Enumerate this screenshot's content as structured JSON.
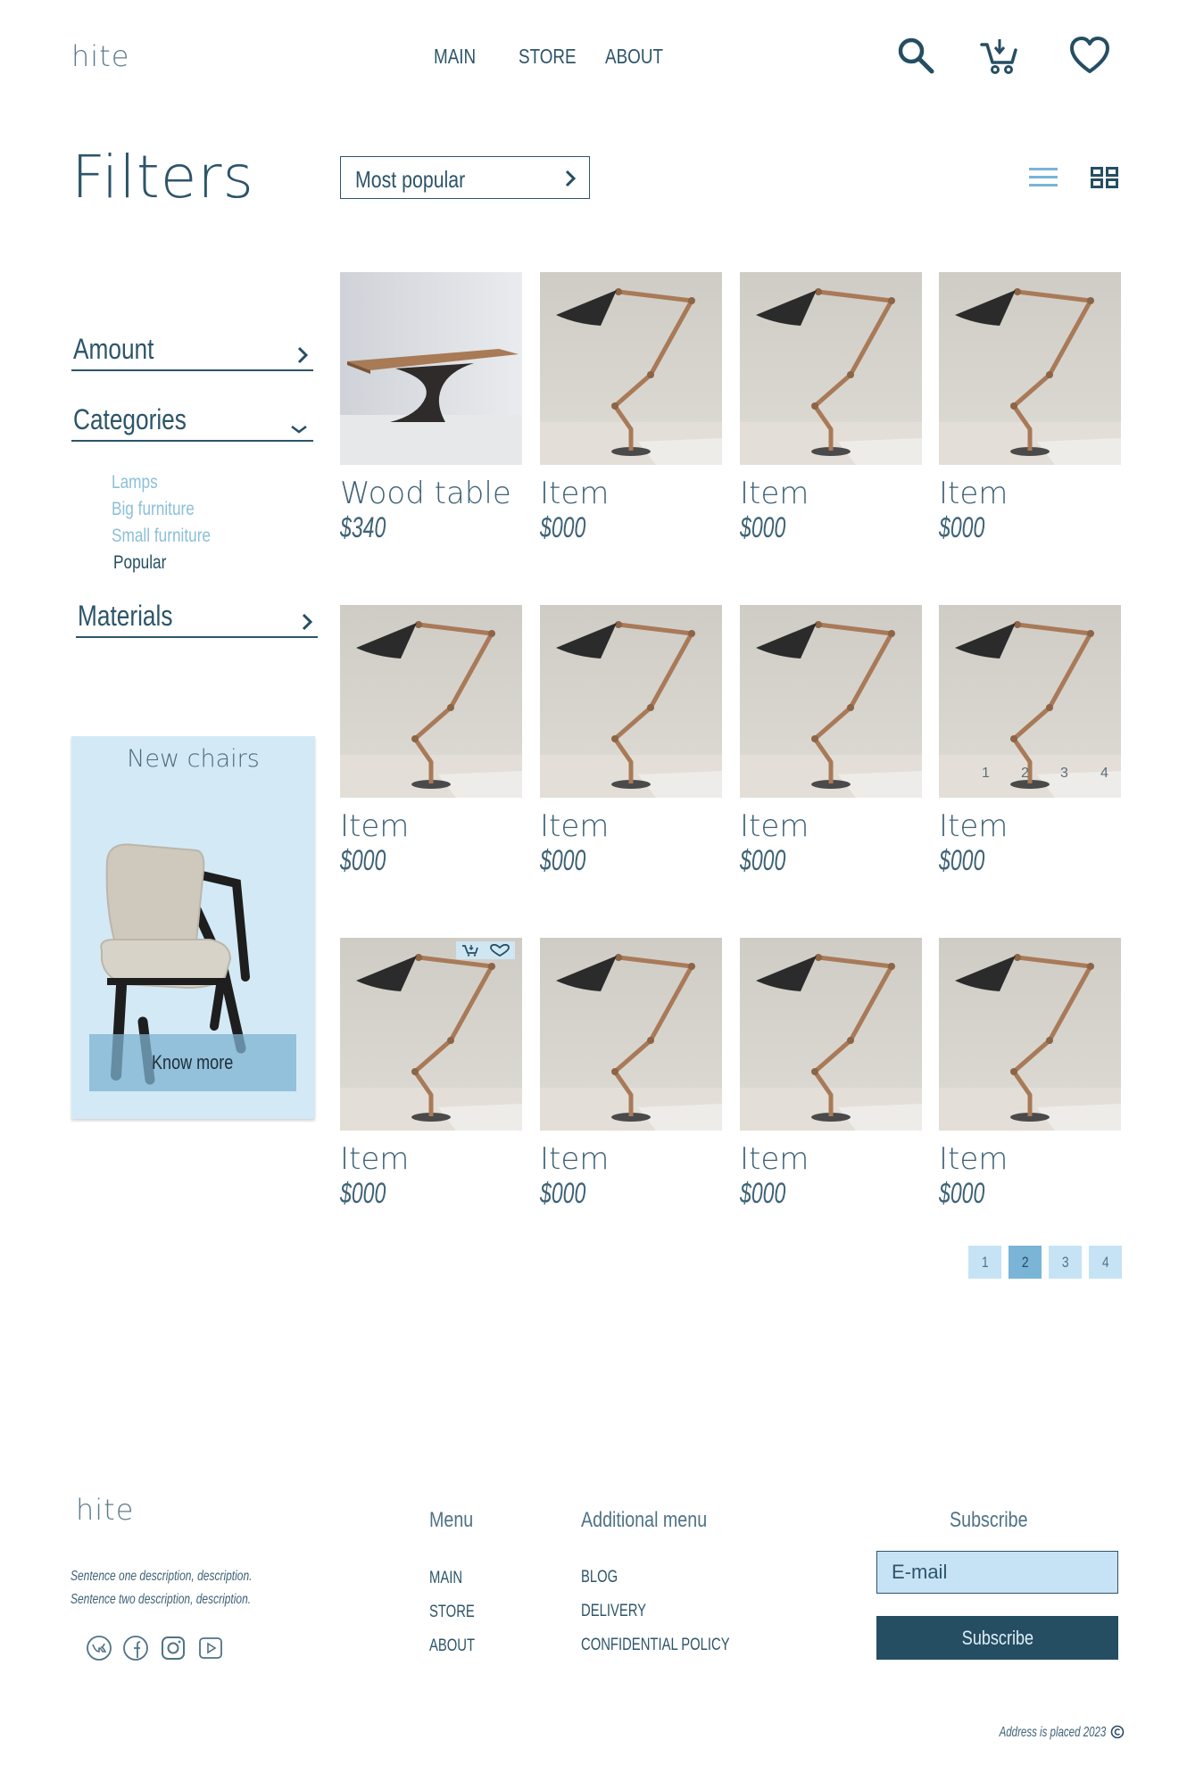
{
  "header": {
    "logo": "hite",
    "nav": [
      "MAIN",
      "STORE",
      "ABOUT"
    ],
    "icons": [
      "search-icon",
      "cart-icon",
      "heart-icon"
    ]
  },
  "filters": {
    "title": "Filters",
    "sort_value": "Most popular",
    "view_icons": [
      "list-view-icon",
      "grid-view-icon"
    ],
    "groups": {
      "amount": "Amount",
      "categories": "Categories",
      "materials": "Materials"
    },
    "categories": [
      "Lamps",
      "Big furniture",
      "Small furniture",
      "Popular"
    ],
    "active_category": "Popular"
  },
  "promo": {
    "title": "New chairs",
    "button": "Know more"
  },
  "products": [
    {
      "name": "Wood table",
      "price": "$340",
      "image": "table"
    },
    {
      "name": "Item",
      "price": "$000",
      "image": "lamp"
    },
    {
      "name": "Item",
      "price": "$000",
      "image": "lamp"
    },
    {
      "name": "Item",
      "price": "$000",
      "image": "lamp"
    },
    {
      "name": "Item",
      "price": "$000",
      "image": "lamp"
    },
    {
      "name": "Item",
      "price": "$000",
      "image": "lamp"
    },
    {
      "name": "Item",
      "price": "$000",
      "image": "lamp"
    },
    {
      "name": "Item",
      "price": "$000",
      "image": "lamp"
    },
    {
      "name": "Item",
      "price": "$000",
      "image": "lamp"
    },
    {
      "name": "Item",
      "price": "$000",
      "image": "lamp"
    },
    {
      "name": "Item",
      "price": "$000",
      "image": "lamp"
    },
    {
      "name": "Item",
      "price": "$000",
      "image": "lamp"
    }
  ],
  "overlay_pages": [
    "1",
    "2",
    "3",
    "4"
  ],
  "pagination": {
    "pages": [
      "1",
      "2",
      "3",
      "4"
    ],
    "current": "2"
  },
  "footer": {
    "logo": "hite",
    "description": [
      "Sentence one description, description.",
      "Sentence two description, description."
    ],
    "social_icons": [
      "vk-icon",
      "facebook-icon",
      "instagram-icon",
      "youtube-icon"
    ],
    "menu_title": "Menu",
    "menu": [
      "MAIN",
      "STORE",
      "ABOUT"
    ],
    "additional_title": "Additional menu",
    "additional": [
      "BLOG",
      "DELIVERY",
      "CONFIDENTIAL POLICY"
    ],
    "subscribe_title": "Subscribe",
    "email_placeholder": "E-mail",
    "subscribe_button": "Subscribe",
    "copyright": "Address is placed 2023",
    "copyright_icon": "copyright-icon"
  },
  "colors": {
    "primary": "#254e63",
    "light_blue": "#c6e3f5",
    "accent_blue": "#7ab4d7",
    "promo_bg": "#d3e9f6"
  }
}
